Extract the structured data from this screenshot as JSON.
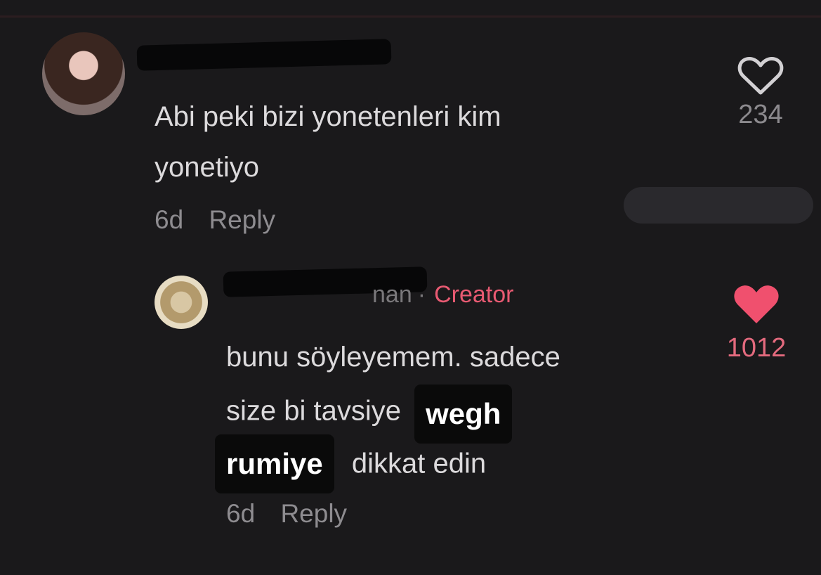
{
  "comment_1": {
    "text_line1": "Abi peki bizi yonetenleri kim",
    "text_line2": "yonetiyo",
    "time": "6d",
    "reply_label": "Reply",
    "like_count": "234",
    "liked": false
  },
  "comment_2": {
    "username_visible": "nan",
    "separator": "·",
    "badge": "Creator",
    "text_line1": "bunu söyleyemem. sadece",
    "text_line2_prefix": "size bi tavsiye",
    "sticker_1": "wegh",
    "sticker_2": "rumiye",
    "text_line3_suffix": "dikkat edin",
    "time": "6d",
    "reply_label": "Reply",
    "like_count": "1012",
    "liked": true
  },
  "icons": {
    "like_outline": "heart-outline-icon",
    "like_filled": "heart-filled-icon"
  },
  "colors": {
    "background": "#1a191b",
    "text": "#dcdadc",
    "muted": "#8e8c90",
    "creator_accent": "#e85a72",
    "liked_heart": "#f0506e"
  }
}
